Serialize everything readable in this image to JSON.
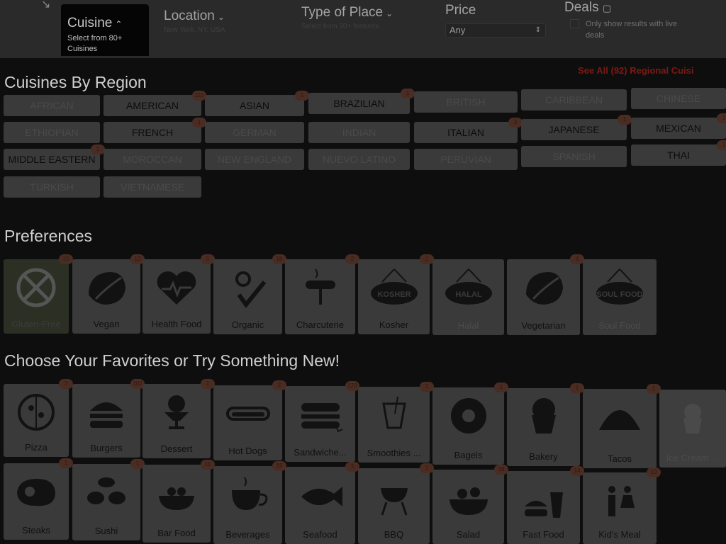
{
  "filters": {
    "cuisine": {
      "title": "Cuisine",
      "subtitle": "Select from 80+ Cuisines"
    },
    "location": {
      "title": "Location",
      "subtitle": "New York, NY, USA"
    },
    "type_of_place": {
      "title": "Type of Place",
      "subtitle": "Select from 20+ features"
    },
    "price": {
      "title": "Price",
      "selected": "Any"
    },
    "deals": {
      "title": "Deals",
      "note": "Only show results with live deals"
    }
  },
  "regions": {
    "title": "Cuisines By Region",
    "see_all": "See All (92) Regional Cuisi",
    "items": [
      {
        "label": "AFRICAN",
        "count": "",
        "dim": true
      },
      {
        "label": "AMERICAN",
        "count": "110",
        "dim": false
      },
      {
        "label": "ASIAN",
        "count": "1",
        "dim": false
      },
      {
        "label": "BRAZILIAN",
        "count": "1",
        "dim": false
      },
      {
        "label": "BRITISH",
        "count": "",
        "dim": true
      },
      {
        "label": "CARIBBEAN",
        "count": "",
        "dim": true
      },
      {
        "label": "CHINESE",
        "count": "",
        "dim": true
      },
      {
        "label": "ETHIOPIAN",
        "count": "",
        "dim": true
      },
      {
        "label": "FRENCH",
        "count": "1",
        "dim": false
      },
      {
        "label": "GERMAN",
        "count": "",
        "dim": true
      },
      {
        "label": "INDIAN",
        "count": "",
        "dim": true
      },
      {
        "label": "ITALIAN",
        "count": "3",
        "dim": false
      },
      {
        "label": "JAPANESE",
        "count": "1",
        "dim": false
      },
      {
        "label": "MEXICAN",
        "count": "1",
        "dim": false
      },
      {
        "label": "MIDDLE EASTERN",
        "count": "1",
        "dim": false
      },
      {
        "label": "MOROCCAN",
        "count": "",
        "dim": true
      },
      {
        "label": "NEW ENGLAND",
        "count": "",
        "dim": true
      },
      {
        "label": "NUEVO LATINO",
        "count": "",
        "dim": true
      },
      {
        "label": "PERUVIAN",
        "count": "",
        "dim": true
      },
      {
        "label": "SPANISH",
        "count": "",
        "dim": true
      },
      {
        "label": "THAI",
        "count": "1",
        "dim": false
      },
      {
        "label": "TURKISH",
        "count": "",
        "dim": true
      },
      {
        "label": "VIETNAMESE",
        "count": "",
        "dim": true
      }
    ]
  },
  "preferences": {
    "title": "Preferences",
    "items": [
      {
        "label": "Gluten-Free",
        "count": "15",
        "icon": "gluten-free-icon"
      },
      {
        "label": "Vegan",
        "count": "12",
        "icon": "leaf-icon"
      },
      {
        "label": "Health Food",
        "count": "5",
        "icon": "heart-icon"
      },
      {
        "label": "Organic",
        "count": "18",
        "icon": "organic-icon"
      },
      {
        "label": "Charcuterie",
        "count": "2",
        "icon": "charcuterie-icon"
      },
      {
        "label": "Kosher",
        "count": "2",
        "icon": "kosher-sign-icon",
        "sign": "KOSHER"
      },
      {
        "label": "Halal",
        "count": "",
        "icon": "halal-sign-icon",
        "sign": "HALAL"
      },
      {
        "label": "Vegetarian",
        "count": "8",
        "icon": "leaf-icon"
      },
      {
        "label": "Soul Food",
        "count": "",
        "icon": "soul-food-sign-icon",
        "sign": "SOUL FOOD"
      }
    ]
  },
  "favorites": {
    "title": "Choose Your Favorites or Try Something New!",
    "items": [
      {
        "label": "Pizza",
        "count": "3",
        "icon": "pizza-icon"
      },
      {
        "label": "Burgers",
        "count": "102",
        "icon": "burger-icon"
      },
      {
        "label": "Dessert",
        "count": "1",
        "icon": "dessert-icon"
      },
      {
        "label": "Hot Dogs",
        "count": "2",
        "icon": "hot-dog-icon"
      },
      {
        "label": "Sandwiche...",
        "count": "123",
        "icon": "sandwich-icon"
      },
      {
        "label": "Smoothies ...",
        "count": "1",
        "icon": "smoothie-icon"
      },
      {
        "label": "Bagels",
        "count": "1",
        "icon": "bagel-icon"
      },
      {
        "label": "Bakery",
        "count": "1",
        "icon": "muffin-icon"
      },
      {
        "label": "Tacos",
        "count": "1",
        "icon": "taco-icon"
      },
      {
        "label": "Ice Cream ...",
        "count": "",
        "icon": "cupcake-icon"
      },
      {
        "label": "Steaks",
        "count": "1",
        "icon": "steak-icon"
      },
      {
        "label": "Sushi",
        "count": "1",
        "icon": "sushi-icon"
      },
      {
        "label": "Bar Food",
        "count": "11",
        "icon": "bar-food-icon"
      },
      {
        "label": "Beverages",
        "count": "19",
        "icon": "coffee-cup-icon"
      },
      {
        "label": "Seafood",
        "count": "3",
        "icon": "fish-icon"
      },
      {
        "label": "BBQ",
        "count": "1",
        "icon": "grill-icon"
      },
      {
        "label": "Salad",
        "count": "18",
        "icon": "salad-icon"
      },
      {
        "label": "Fast Food",
        "count": "14",
        "icon": "fast-food-icon"
      },
      {
        "label": "Kid's Meal",
        "count": "10",
        "icon": "kids-icon"
      }
    ]
  }
}
